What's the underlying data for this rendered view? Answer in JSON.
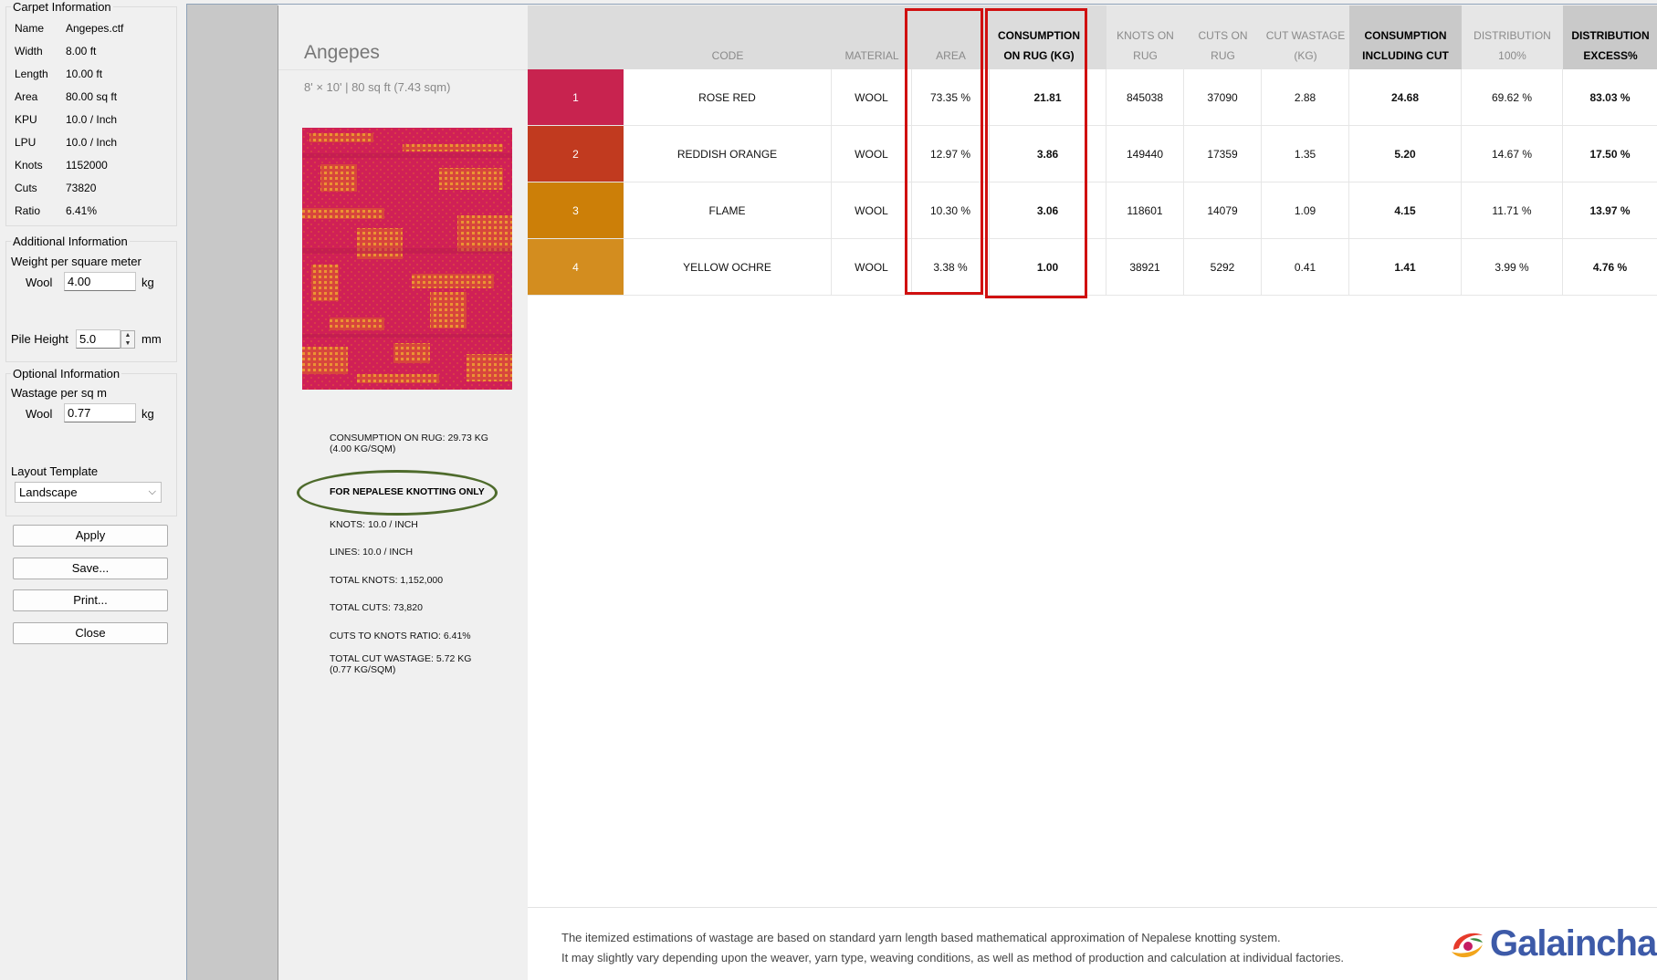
{
  "left": {
    "carpet_info": {
      "legend": "Carpet Information",
      "rows": [
        {
          "key": "Name",
          "value": "Angepes.ctf"
        },
        {
          "key": "Width",
          "value": "8.00 ft"
        },
        {
          "key": "Length",
          "value": "10.00 ft"
        },
        {
          "key": "Area",
          "value": "80.00 sq ft"
        },
        {
          "key": "KPU",
          "value": "10.0 / Inch"
        },
        {
          "key": "LPU",
          "value": "10.0 / Inch"
        },
        {
          "key": "Knots",
          "value": "1152000"
        },
        {
          "key": "Cuts",
          "value": "73820"
        },
        {
          "key": "Ratio",
          "value": "6.41%"
        }
      ]
    },
    "additional": {
      "legend": "Additional Information",
      "weight_label": "Weight per square meter",
      "wool_label": "Wool",
      "wool_value": "4.00",
      "unit": "kg"
    },
    "pile": {
      "label": "Pile Height",
      "value": "5.0",
      "unit": "mm"
    },
    "optional": {
      "legend": "Optional Information",
      "wastage_label": "Wastage per sq m",
      "wool_label": "Wool",
      "wool_value": "0.77",
      "unit": "kg"
    },
    "layout": {
      "legend": "Layout Template",
      "selected": "Landscape"
    },
    "buttons": {
      "apply": "Apply",
      "save": "Save...",
      "print": "Print...",
      "close": "Close"
    }
  },
  "report": {
    "rug_name": "Angepes",
    "rug_size": "8' × 10' | 80 sq ft (7.43 sqm)",
    "consumption_line1": "CONSUMPTION ON RUG: 29.73 KG",
    "consumption_line2": "(4.00 KG/SQM)",
    "nepal_note": "FOR NEPALESE KNOTTING ONLY",
    "knots": "KNOTS: 10.0 / INCH",
    "lines": "LINES: 10.0 / INCH",
    "total_knots": "TOTAL KNOTS: 1,152,000",
    "total_cuts": "TOTAL CUTS: 73,820",
    "ratio": "CUTS TO KNOTS RATIO: 6.41%",
    "wastage_line1": "TOTAL CUT WASTAGE: 5.72 KG",
    "wastage_line2": "(0.77 KG/SQM)",
    "headers": {
      "code": "CODE",
      "material": "MATERIAL",
      "area": "AREA",
      "cons_l1": "CONSUMPTION",
      "cons_l2": "ON RUG (KG)",
      "knots_l1": "KNOTS ON",
      "knots_l2": "RUG",
      "cuts_l1": "CUTS ON",
      "cuts_l2": "RUG",
      "wast_l1": "CUT WASTAGE",
      "wast_l2": "(KG)",
      "incl_l1": "CONSUMPTION",
      "incl_l2": "INCLUDING CUT",
      "dist_l1": "DISTRIBUTION",
      "dist_l2": "100%",
      "exc_l1": "DISTRIBUTION",
      "exc_l2": "EXCESS%"
    },
    "rows": [
      {
        "num": "1",
        "color": "#c8234f",
        "code": "ROSE RED",
        "material": "WOOL",
        "area": "73.35 %",
        "consumption": "21.81",
        "knots": "845038",
        "cuts": "37090",
        "wastage": "2.88",
        "incl": "24.68",
        "dist": "69.62 %",
        "excess": "83.03 %"
      },
      {
        "num": "2",
        "color": "#c13a1f",
        "code": "REDDISH ORANGE",
        "material": "WOOL",
        "area": "12.97 %",
        "consumption": "3.86",
        "knots": "149440",
        "cuts": "17359",
        "wastage": "1.35",
        "incl": "5.20",
        "dist": "14.67 %",
        "excess": "17.50 %"
      },
      {
        "num": "3",
        "color": "#cc7f08",
        "code": "FLAME",
        "material": "WOOL",
        "area": "10.30 %",
        "consumption": "3.06",
        "knots": "118601",
        "cuts": "14079",
        "wastage": "1.09",
        "incl": "4.15",
        "dist": "11.71 %",
        "excess": "13.97 %"
      },
      {
        "num": "4",
        "color": "#d38d1f",
        "code": "YELLOW OCHRE",
        "material": "WOOL",
        "area": "3.38 %",
        "consumption": "1.00",
        "knots": "38921",
        "cuts": "5292",
        "wastage": "0.41",
        "incl": "1.41",
        "dist": "3.99 %",
        "excess": "4.76 %"
      }
    ],
    "footer_line1": "The itemized estimations of wastage are based on standard yarn length based mathematical approximation of Nepalese knotting system.",
    "footer_line2": "It may slightly vary depending upon the weaver, yarn type, weaving conditions, as well as method of production and calculation at individual factories.",
    "logo": "Galaincha"
  }
}
